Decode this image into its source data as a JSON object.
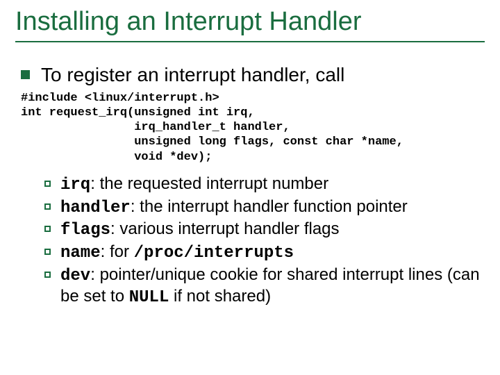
{
  "title": "Installing an Interrupt Handler",
  "lead": "To register an interrupt handler, call",
  "code": "#include <linux/interrupt.h>\nint request_irq(unsigned int irq,\n                irq_handler_t handler,\n                unsigned long flags, const char *name,\n                void *dev);",
  "items": [
    {
      "term": "irq",
      "colon": ":  ",
      "desc1": "the requested interrupt number",
      "mono2": "",
      "desc2": ""
    },
    {
      "term": "handler",
      "colon": ":  ",
      "desc1": "the interrupt handler function pointer",
      "mono2": "",
      "desc2": ""
    },
    {
      "term": "flags",
      "colon": ":  ",
      "desc1": "various interrupt handler flags",
      "mono2": "",
      "desc2": ""
    },
    {
      "term": "name",
      "colon": ":  ",
      "desc1": "for ",
      "mono2": "/proc/interrupts",
      "desc2": ""
    },
    {
      "term": "dev",
      "colon": ":  ",
      "desc1": "pointer/unique cookie for shared interrupt lines (can be set to ",
      "mono2": "NULL",
      "desc2": " if not shared)"
    }
  ]
}
